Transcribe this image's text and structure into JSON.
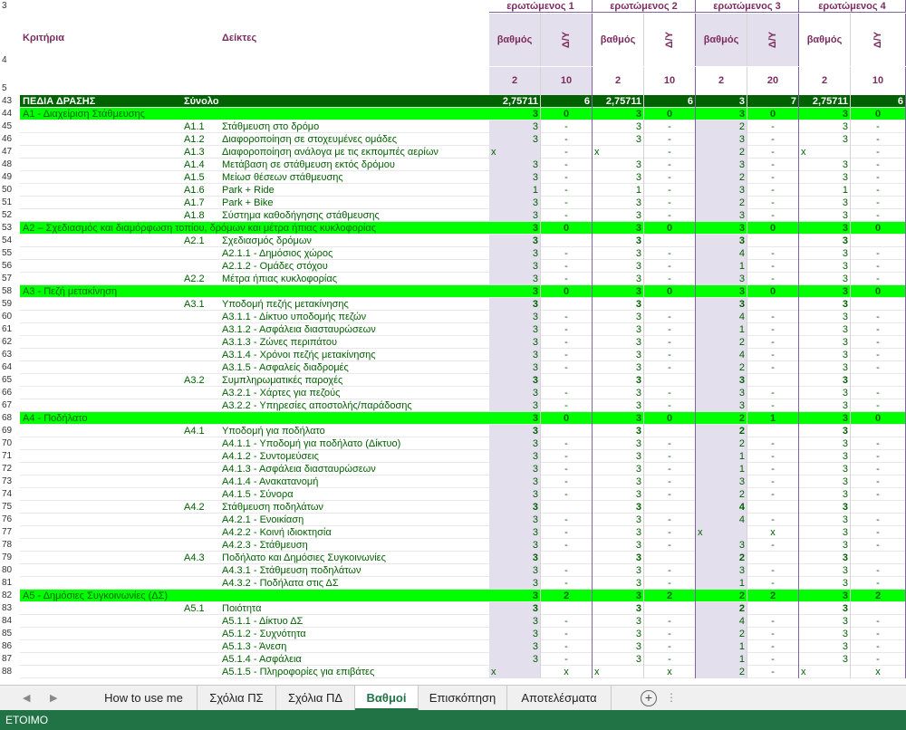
{
  "header": {
    "row3_num": "3",
    "row4_num": "4",
    "row5_num": "5",
    "respondents": [
      {
        "title": "ερωτώμενος 1",
        "score": "βαθμός",
        "delta": "Δ/Υ",
        "w_score": "2",
        "w_delta": "10"
      },
      {
        "title": "ερωτώμενος 2",
        "score": "βαθμός",
        "delta": "Δ/Υ",
        "w_score": "2",
        "w_delta": "10"
      },
      {
        "title": "ερωτώμενος 3",
        "score": "βαθμός",
        "delta": "Δ/Υ",
        "w_score": "2",
        "w_delta": "20"
      },
      {
        "title": "ερωτώμενος 4",
        "score": "βαθμός",
        "delta": "Δ/Υ",
        "w_score": "2",
        "w_delta": "10"
      }
    ],
    "criteria_label": "Κριτήρια",
    "indicators_label": "Δείκτες"
  },
  "rows": [
    {
      "n": "43",
      "type": "dark",
      "code": "ΠΕΔΙΑ ΔΡΑΣΗΣ",
      "text": "Σύνολο",
      "v": [
        "2,75711",
        "6",
        "2,75711",
        "6",
        "3",
        "7",
        "2,75711",
        "6"
      ]
    },
    {
      "n": "44",
      "type": "green",
      "code": "Α1 - Διαχείριση Στάθμευσης",
      "text": "",
      "v": [
        "3",
        "0",
        "3",
        "0",
        "3",
        "0",
        "3",
        "0"
      ]
    },
    {
      "n": "45",
      "type": "item",
      "code": "Α1.1",
      "text": "Στάθμευση στο δρόμο",
      "v": [
        "3",
        "-",
        "3",
        "-",
        "2",
        "-",
        "3",
        "-"
      ]
    },
    {
      "n": "46",
      "type": "item",
      "code": "Α1.2",
      "text": "Διαφοροποίηση σε στοχευμένες ομάδες",
      "v": [
        "3",
        "-",
        "3",
        "-",
        "3",
        "-",
        "3",
        "-"
      ]
    },
    {
      "n": "47",
      "type": "item",
      "code": "Α1.3",
      "text": "Διαφοροποίηση ανάλογα με τις εκπομπές αερίων",
      "v": [
        "x",
        "-",
        "x",
        "-",
        "2",
        "-",
        "x",
        "-"
      ]
    },
    {
      "n": "48",
      "type": "item",
      "code": "Α1.4",
      "text": "Μετάβαση σε στάθμευση εκτός δρόμου",
      "v": [
        "3",
        "-",
        "3",
        "-",
        "3",
        "-",
        "3",
        "-"
      ]
    },
    {
      "n": "49",
      "type": "item",
      "code": "Α1.5",
      "text": "Μείωσ θέσεων στάθμευσης",
      "v": [
        "3",
        "-",
        "3",
        "-",
        "2",
        "-",
        "3",
        "-"
      ]
    },
    {
      "n": "50",
      "type": "item",
      "code": "Α1.6",
      "text": "Park + Ride",
      "v": [
        "1",
        "-",
        "1",
        "-",
        "3",
        "-",
        "1",
        "-"
      ]
    },
    {
      "n": "51",
      "type": "item",
      "code": "Α1.7",
      "text": "Park + Bike",
      "v": [
        "3",
        "-",
        "3",
        "-",
        "2",
        "-",
        "3",
        "-"
      ]
    },
    {
      "n": "52",
      "type": "item",
      "code": "Α1.8",
      "text": "Σύστημα καθοδήγησης στάθμευσης",
      "v": [
        "3",
        "-",
        "3",
        "-",
        "3",
        "-",
        "3",
        "-"
      ]
    },
    {
      "n": "53",
      "type": "green",
      "code": "Α2 – Σχεδιασμός και διαμόρφωση τοπίου, δρόμων και μέτρα ήπιας κυκλοφορίας",
      "text": "",
      "v": [
        "3",
        "0",
        "3",
        "0",
        "3",
        "0",
        "3",
        "0"
      ]
    },
    {
      "n": "54",
      "type": "item",
      "code": "Α2.1",
      "text": "Σχεδιασμός δρόμων",
      "v": [
        "3",
        "",
        "3",
        "",
        "3",
        "",
        "3",
        ""
      ],
      "bold": true
    },
    {
      "n": "55",
      "type": "sub",
      "code": "",
      "text": "Α2.1.1 - Δημόσιος χώρος",
      "v": [
        "3",
        "-",
        "3",
        "-",
        "4",
        "-",
        "3",
        "-"
      ]
    },
    {
      "n": "56",
      "type": "sub",
      "code": "",
      "text": "Α2.1.2 - Ομάδες στόχου",
      "v": [
        "3",
        "-",
        "3",
        "-",
        "1",
        "-",
        "3",
        "-"
      ]
    },
    {
      "n": "57",
      "type": "item",
      "code": "Α2.2",
      "text": "Μέτρα ήπιας κυκλοφορίας",
      "v": [
        "3",
        "-",
        "3",
        "-",
        "3",
        "-",
        "3",
        "-"
      ]
    },
    {
      "n": "58",
      "type": "green",
      "code": "Α3 - Πεζή μετακίνηση",
      "text": "",
      "v": [
        "3",
        "0",
        "3",
        "0",
        "3",
        "0",
        "3",
        "0"
      ]
    },
    {
      "n": "59",
      "type": "item",
      "code": "Α3.1",
      "text": "Υποδομή πεζής μετακίνησης",
      "v": [
        "3",
        "",
        "3",
        "",
        "3",
        "",
        "3",
        ""
      ],
      "bold": true
    },
    {
      "n": "60",
      "type": "sub",
      "code": "",
      "text": "Α3.1.1 - Δίκτυο υποδομής πεζών",
      "v": [
        "3",
        "-",
        "3",
        "-",
        "4",
        "-",
        "3",
        "-"
      ]
    },
    {
      "n": "61",
      "type": "sub",
      "code": "",
      "text": "Α3.1.2 - Ασφάλεια διασταυρώσεων",
      "v": [
        "3",
        "-",
        "3",
        "-",
        "1",
        "-",
        "3",
        "-"
      ]
    },
    {
      "n": "62",
      "type": "sub",
      "code": "",
      "text": "Α3.1.3 - Ζώνες περιπάτου",
      "v": [
        "3",
        "-",
        "3",
        "-",
        "2",
        "-",
        "3",
        "-"
      ]
    },
    {
      "n": "63",
      "type": "sub",
      "code": "",
      "text": "Α3.1.4 - Χρόνοι πεζής μετακίνησης",
      "v": [
        "3",
        "-",
        "3",
        "-",
        "4",
        "-",
        "3",
        "-"
      ]
    },
    {
      "n": "64",
      "type": "sub",
      "code": "",
      "text": "Α3.1.5 - Ασφαλείς διαδρομές",
      "v": [
        "3",
        "-",
        "3",
        "-",
        "2",
        "-",
        "3",
        "-"
      ]
    },
    {
      "n": "65",
      "type": "item",
      "code": "Α3.2",
      "text": "Συμπληρωματικές παροχές",
      "v": [
        "3",
        "",
        "3",
        "",
        "3",
        "",
        "3",
        ""
      ],
      "bold": true
    },
    {
      "n": "66",
      "type": "sub",
      "code": "",
      "text": "Α3.2.1 - Χάρτες για πεζούς",
      "v": [
        "3",
        "-",
        "3",
        "-",
        "3",
        "-",
        "3",
        "-"
      ]
    },
    {
      "n": "67",
      "type": "sub",
      "code": "",
      "text": "Α3.2.2 - Υπηρεσίες αποστολής/παράδοσης",
      "v": [
        "3",
        "-",
        "3",
        "-",
        "3",
        "-",
        "3",
        "-"
      ]
    },
    {
      "n": "68",
      "type": "green",
      "code": "Α4 - Ποδήλατο",
      "text": "",
      "v": [
        "3",
        "0",
        "3",
        "0",
        "2",
        "1",
        "3",
        "0"
      ]
    },
    {
      "n": "69",
      "type": "item",
      "code": "Α4.1",
      "text": "Υποδομή για ποδήλατο",
      "v": [
        "3",
        "",
        "3",
        "",
        "2",
        "",
        "3",
        ""
      ],
      "bold": true
    },
    {
      "n": "70",
      "type": "sub",
      "code": "",
      "text": "Α4.1.1 - Υποδομή για ποδήλατο (Δίκτυο)",
      "v": [
        "3",
        "-",
        "3",
        "-",
        "2",
        "-",
        "3",
        "-"
      ]
    },
    {
      "n": "71",
      "type": "sub",
      "code": "",
      "text": "Α4.1.2 - Συντομεύσεις",
      "v": [
        "3",
        "-",
        "3",
        "-",
        "1",
        "-",
        "3",
        "-"
      ]
    },
    {
      "n": "72",
      "type": "sub",
      "code": "",
      "text": "Α4.1.3 - Ασφάλεια διασταυρώσεων",
      "v": [
        "3",
        "-",
        "3",
        "-",
        "1",
        "-",
        "3",
        "-"
      ]
    },
    {
      "n": "73",
      "type": "sub",
      "code": "",
      "text": "Α4.1.4 - Ανακατανομή",
      "v": [
        "3",
        "-",
        "3",
        "-",
        "3",
        "-",
        "3",
        "-"
      ]
    },
    {
      "n": "74",
      "type": "sub",
      "code": "",
      "text": "Α4.1.5 - Σύνορα",
      "v": [
        "3",
        "-",
        "3",
        "-",
        "2",
        "-",
        "3",
        "-"
      ]
    },
    {
      "n": "75",
      "type": "item",
      "code": "Α4.2",
      "text": "Στάθμευση ποδηλάτων",
      "v": [
        "3",
        "",
        "3",
        "",
        "4",
        "",
        "3",
        ""
      ],
      "bold": true
    },
    {
      "n": "76",
      "type": "sub",
      "code": "",
      "text": "Α4.2.1 - Ενοικίαση",
      "v": [
        "3",
        "-",
        "3",
        "-",
        "4",
        "-",
        "3",
        "-"
      ]
    },
    {
      "n": "77",
      "type": "sub",
      "code": "",
      "text": "Α4.2.2 - Κοινή ιδιοκτησία",
      "v": [
        "3",
        "-",
        "3",
        "-",
        "x",
        "x",
        "3",
        "-"
      ]
    },
    {
      "n": "78",
      "type": "sub",
      "code": "",
      "text": "Α4.2.3 - Στάθμευση",
      "v": [
        "3",
        "-",
        "3",
        "-",
        "3",
        "-",
        "3",
        "-"
      ]
    },
    {
      "n": "79",
      "type": "item",
      "code": "Α4.3",
      "text": "Ποδήλατο και Δημόσιες Συγκοινωνίες",
      "v": [
        "3",
        "",
        "3",
        "",
        "2",
        "",
        "3",
        ""
      ],
      "bold": true
    },
    {
      "n": "80",
      "type": "sub",
      "code": "",
      "text": "Α4.3.1 - Στάθμευση ποδηλάτων",
      "v": [
        "3",
        "-",
        "3",
        "-",
        "3",
        "-",
        "3",
        "-"
      ]
    },
    {
      "n": "81",
      "type": "sub",
      "code": "",
      "text": "Α4.3.2 - Ποδήλατα στις ΔΣ",
      "v": [
        "3",
        "-",
        "3",
        "-",
        "1",
        "-",
        "3",
        "-"
      ]
    },
    {
      "n": "82",
      "type": "green",
      "code": "Α5 - Δημόσιες Συγκοινωνίες (ΔΣ)",
      "text": "",
      "v": [
        "3",
        "2",
        "3",
        "2",
        "2",
        "2",
        "3",
        "2"
      ]
    },
    {
      "n": "83",
      "type": "item",
      "code": "Α5.1",
      "text": "Ποιότητα",
      "v": [
        "3",
        "",
        "3",
        "",
        "2",
        "",
        "3",
        ""
      ],
      "bold": true
    },
    {
      "n": "84",
      "type": "sub",
      "code": "",
      "text": "Α5.1.1 - Δίκτυο ΔΣ",
      "v": [
        "3",
        "-",
        "3",
        "-",
        "4",
        "-",
        "3",
        "-"
      ]
    },
    {
      "n": "85",
      "type": "sub",
      "code": "",
      "text": "Α5.1.2 - Συχνότητα",
      "v": [
        "3",
        "-",
        "3",
        "-",
        "2",
        "-",
        "3",
        "-"
      ]
    },
    {
      "n": "86",
      "type": "sub",
      "code": "",
      "text": "Α5.1.3 - Άνεση",
      "v": [
        "3",
        "-",
        "3",
        "-",
        "1",
        "-",
        "3",
        "-"
      ]
    },
    {
      "n": "87",
      "type": "sub",
      "code": "",
      "text": "Α5.1.4 - Ασφάλεια",
      "v": [
        "3",
        "-",
        "3",
        "-",
        "1",
        "-",
        "3",
        "-"
      ]
    },
    {
      "n": "88",
      "type": "sub",
      "code": "",
      "text": "Α5.1.5 - Πληροφορίες για επιβάτες",
      "v": [
        "x",
        "x",
        "x",
        "x",
        "2",
        "-",
        "x",
        "x"
      ]
    }
  ],
  "tabs": [
    {
      "label": "How to use me",
      "active": false
    },
    {
      "label": "Σχόλια ΠΣ",
      "active": false
    },
    {
      "label": "Σχόλια ΠΔ",
      "active": false
    },
    {
      "label": "Βαθμοί",
      "active": true
    },
    {
      "label": "Επισκόπηση",
      "active": false
    },
    {
      "label": "Αποτελέσματα",
      "active": false
    }
  ],
  "tabbar": {
    "prev": "◀",
    "next": "▶",
    "add": "+",
    "more": "⋮"
  },
  "status": {
    "text": "ΕΤΟΙΜΟ"
  },
  "colors": {
    "green": "#00ff00",
    "dark_green": "#006100",
    "lavender": "#e4dfec",
    "header_text": "#7b2d5f",
    "status_bar": "#217346"
  }
}
